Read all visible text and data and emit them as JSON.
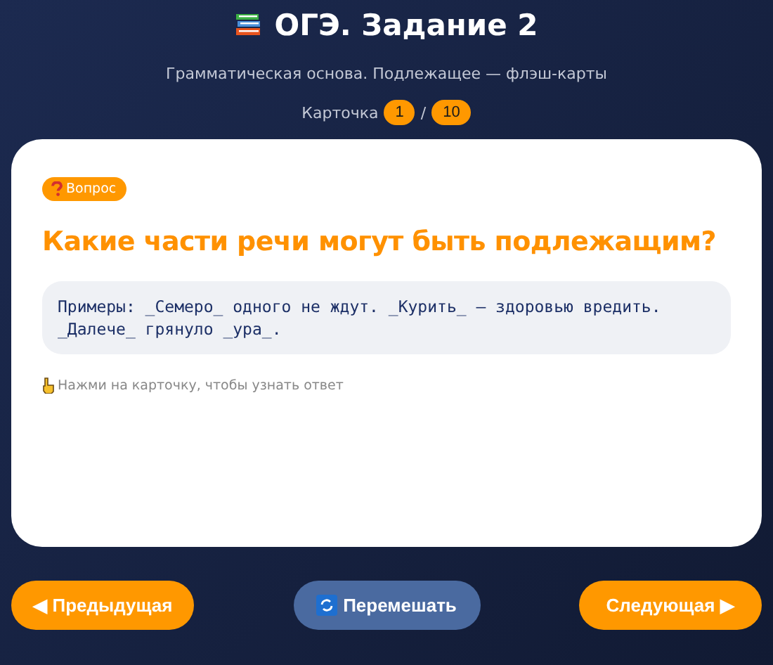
{
  "header": {
    "title": "ОГЭ. Задание 2",
    "subtitle": "Грамматическая основа. Подлежащее — флэш-карты"
  },
  "counter": {
    "label": "Карточка",
    "current": "1",
    "separator": "/",
    "total": "10"
  },
  "card": {
    "badge": "Вопрос",
    "question": "Какие части речи могут быть подлежащим?",
    "example": "Примеры: _Семеро_ одного не ждут. _Курить_ — здоровью вредить. _Далече_ грянуло _ура_.",
    "hint": "Нажми на карточку, чтобы узнать ответ"
  },
  "buttons": [
    {
      "kind": "prev",
      "arrow": "◀",
      "label": "Предыдущая"
    },
    {
      "kind": "shuffle",
      "label": "Перемешать"
    },
    {
      "kind": "next",
      "arrow": "▶",
      "label": "Следующая"
    }
  ]
}
